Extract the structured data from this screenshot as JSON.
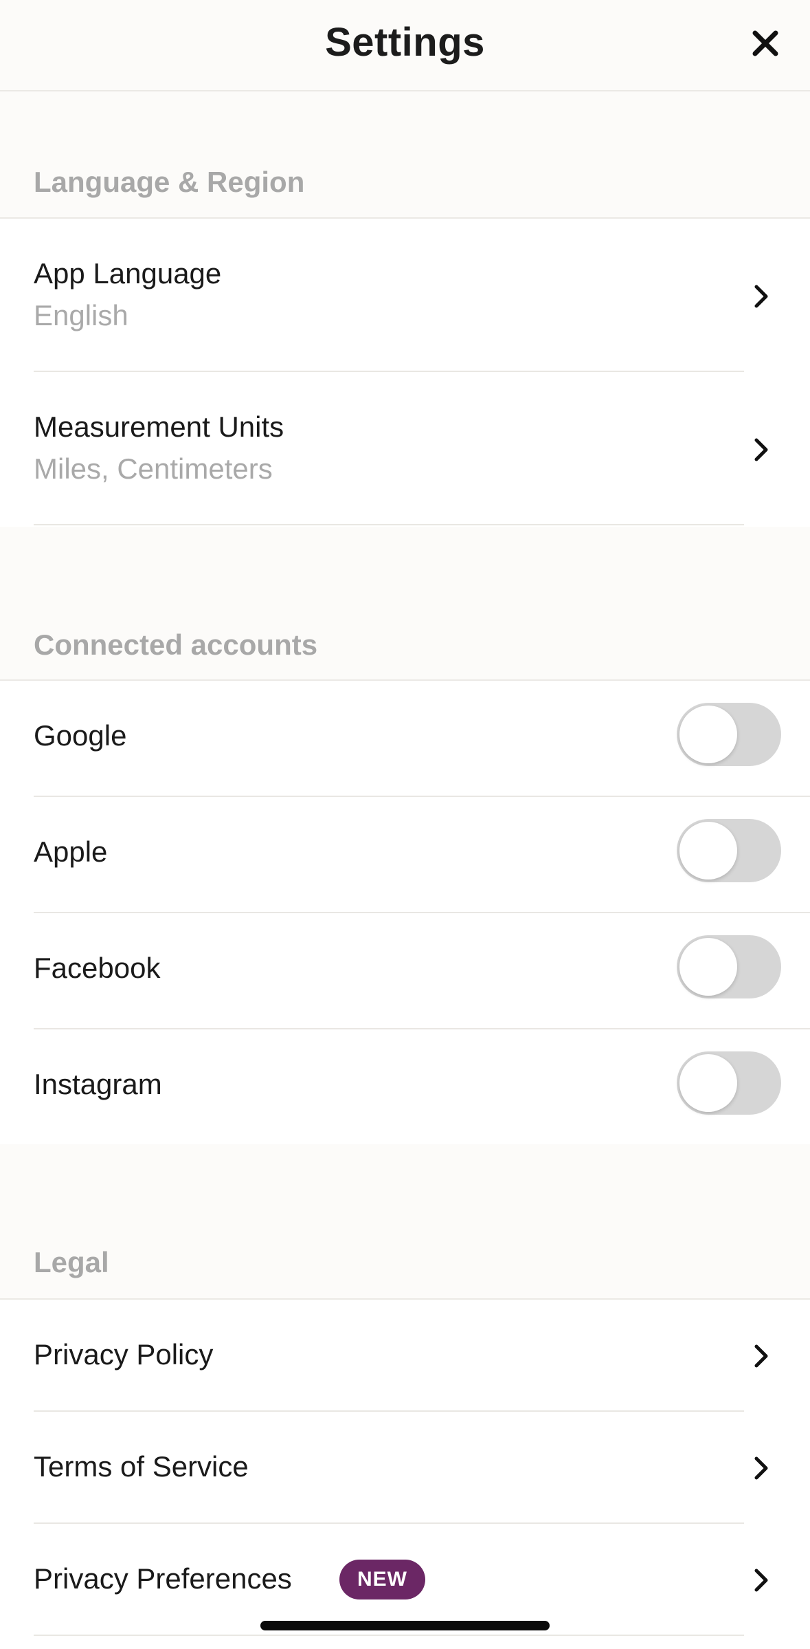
{
  "header": {
    "title": "Settings",
    "close_icon": "close-icon"
  },
  "sections": {
    "language_region": {
      "title": "Language & Region",
      "items": [
        {
          "label": "App Language",
          "value": "English"
        },
        {
          "label": "Measurement Units",
          "value": "Miles, Centimeters"
        }
      ]
    },
    "connected_accounts": {
      "title": "Connected accounts",
      "items": [
        {
          "label": "Google",
          "enabled": false
        },
        {
          "label": "Apple",
          "enabled": false
        },
        {
          "label": "Facebook",
          "enabled": false
        },
        {
          "label": "Instagram",
          "enabled": false
        }
      ]
    },
    "legal": {
      "title": "Legal",
      "items": [
        {
          "label": "Privacy Policy"
        },
        {
          "label": "Terms of Service"
        },
        {
          "label": "Privacy Preferences",
          "badge": "NEW"
        }
      ]
    }
  },
  "colors": {
    "background": "#fcfbf9",
    "badge": "#6b2765",
    "toggle_off": "#d6d6d6",
    "muted_text": "#a9a9a9"
  }
}
